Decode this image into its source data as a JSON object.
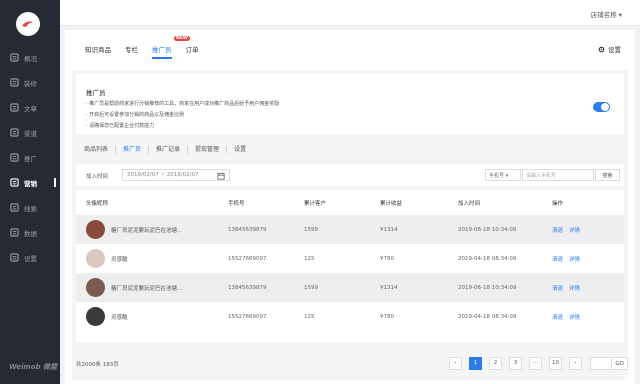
{
  "app": {
    "brand": "Weimob 微盟",
    "store_name": "店铺名称"
  },
  "sidebar": {
    "items": [
      {
        "label": "概况",
        "icon": "dashboard-icon"
      },
      {
        "label": "装修",
        "icon": "brush-icon"
      },
      {
        "label": "文章",
        "icon": "article-icon"
      },
      {
        "label": "渠道",
        "icon": "channel-icon"
      },
      {
        "label": "推广",
        "icon": "promotion-icon"
      },
      {
        "label": "营销",
        "icon": "marketing-icon",
        "active": true
      },
      {
        "label": "线索",
        "icon": "leads-icon"
      },
      {
        "label": "数据",
        "icon": "chart-icon"
      },
      {
        "label": "设置",
        "icon": "gear-icon"
      }
    ]
  },
  "header": {
    "tabs": [
      {
        "label": "知识商品"
      },
      {
        "label": "专栏"
      },
      {
        "label": "推广员",
        "active": true,
        "badge": "NEW"
      },
      {
        "label": "订单"
      }
    ],
    "settings_label": "设置"
  },
  "promo": {
    "title": "推广员",
    "lines": [
      "· 推广员是帮助商家进行分销推荐的工具，商家在用户成功推广商品后给予用户佣金奖励",
      "· 开启后可设置参加分销的商品以及佣金比例",
      "· 请确保您已配置企业付款能力"
    ],
    "enabled": true
  },
  "subtabs": [
    {
      "label": "商品列表"
    },
    {
      "label": "推广员",
      "active": true
    },
    {
      "label": "推广记录"
    },
    {
      "label": "提现管理"
    },
    {
      "label": "设置"
    }
  ],
  "filter": {
    "label": "加入时间",
    "date_range": "2019/02/07 ~ 2019/02/07",
    "phone_select": "手机号",
    "phone_placeholder": "请输入手机号",
    "search_label": "搜索"
  },
  "table": {
    "columns": [
      "头像昵称",
      "手机号",
      "累计客户",
      "累计收益",
      "加入时间",
      "操作"
    ],
    "rows": [
      {
        "nickname": "糖厂员泥泥要玩泥巴在池塘...",
        "phone": "13845639879",
        "customers": "1599",
        "earnings": "¥1314",
        "joined": "2019-06-18 10:34:09",
        "action_clear": "清退",
        "action_detail": "详情",
        "avatar": "#8a4a3a"
      },
      {
        "nickname": "灵感酷",
        "phone": "15527669097",
        "customers": "125",
        "earnings": "¥780",
        "joined": "2019-04-18 08:34:09",
        "action_clear": "清退",
        "action_detail": "详情",
        "avatar": "#d8c8c0"
      },
      {
        "nickname": "糖厂员泥泥要玩泥巴在池塘...",
        "phone": "13845639879",
        "customers": "1599",
        "earnings": "¥1314",
        "joined": "2019-06-18 10:34:09",
        "action_clear": "清退",
        "action_detail": "详情",
        "avatar": "#7a5a4a"
      },
      {
        "nickname": "灵感酷",
        "phone": "15527669097",
        "customers": "125",
        "earnings": "¥780",
        "joined": "2019-04-18 08:34:09",
        "action_clear": "清退",
        "action_detail": "详情",
        "avatar": "#3a3a3a"
      }
    ]
  },
  "footer": {
    "total": "共2000条 183页",
    "pages": [
      "1",
      "2",
      "3",
      "···",
      "10"
    ],
    "current_page": "1",
    "go_label": "GO"
  }
}
